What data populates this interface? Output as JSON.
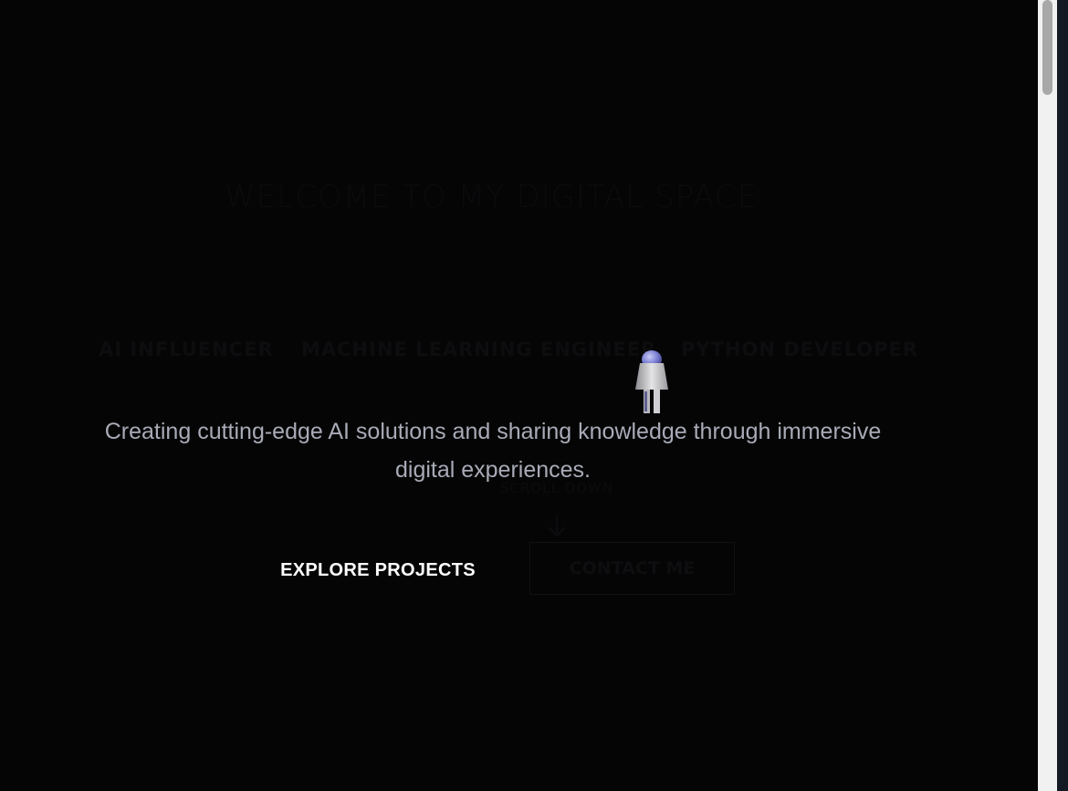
{
  "hero": {
    "welcome": "WELCOME TO MY DIGITAL SPACE",
    "roles": [
      "AI INFLUENCER",
      "MACHINE LEARNING ENGINEER",
      "PYTHON DEVELOPER"
    ],
    "tagline_line1": "Creating cutting-edge AI solutions and sharing knowledge through immersive",
    "tagline_line2": "digital experiences.",
    "scroll_label": "SCROLL DOWN",
    "explore_label": "EXPLORE PROJECTS",
    "contact_label": "CONTACT ME"
  },
  "icons": {
    "robot": "robot-icon",
    "scroll_arrow": "arrow-down-icon"
  },
  "colors": {
    "background": "#050506",
    "tagline": "#a8abb6",
    "button_text": "#ffffff",
    "robot_head": "#7b7fd4"
  }
}
